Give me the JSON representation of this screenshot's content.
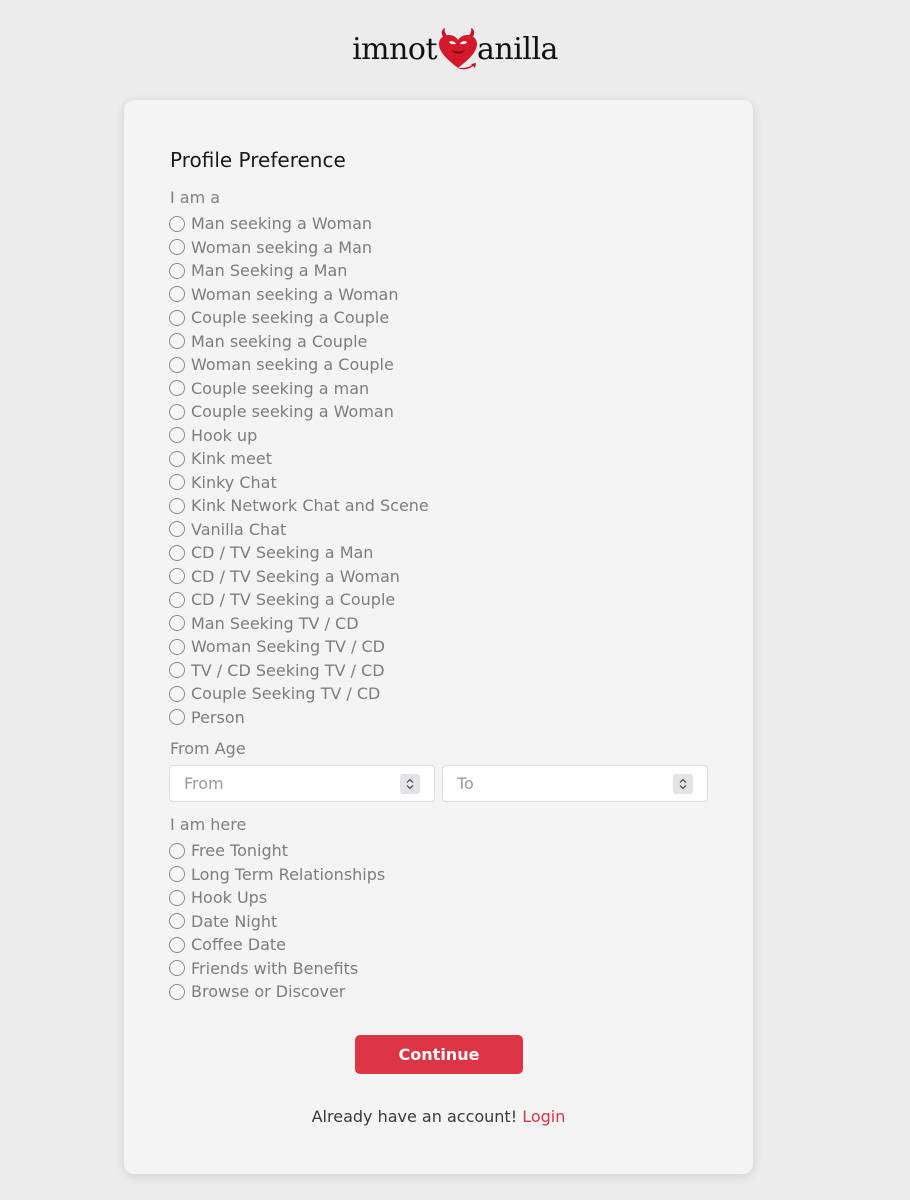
{
  "brand": {
    "name_prefix": "imnot",
    "name_suffix": "anilla",
    "accent_color": "#dc3545"
  },
  "form": {
    "title": "Profile Preference",
    "iam_label": "I am a",
    "iam_options": [
      "Man seeking a Woman",
      "Woman seeking a Man",
      "Man Seeking a Man",
      "Woman seeking a Woman",
      "Couple seeking a Couple",
      "Man seeking a Couple",
      "Woman seeking a Couple",
      "Couple seeking a man",
      "Couple seeking a Woman",
      "Hook up",
      "Kink meet",
      "Kinky Chat",
      "Kink Network Chat and Scene",
      "Vanilla Chat",
      "CD / TV Seeking a Man",
      "CD / TV Seeking a Woman",
      "CD / TV Seeking a Couple",
      "Man Seeking TV / CD",
      "Woman Seeking TV / CD",
      "TV / CD Seeking TV / CD",
      "Couple Seeking TV / CD",
      "Person"
    ],
    "age_label": "From Age",
    "age_from_placeholder": "From",
    "age_to_placeholder": "To",
    "here_label": "I am here",
    "here_options": [
      "Free Tonight",
      "Long Term Relationships",
      "Hook Ups",
      "Date Night",
      "Coffee Date",
      "Friends with Benefits",
      "Browse or Discover"
    ],
    "continue_label": "Continue",
    "login_prompt": "Already have an account! ",
    "login_link": "Login"
  }
}
